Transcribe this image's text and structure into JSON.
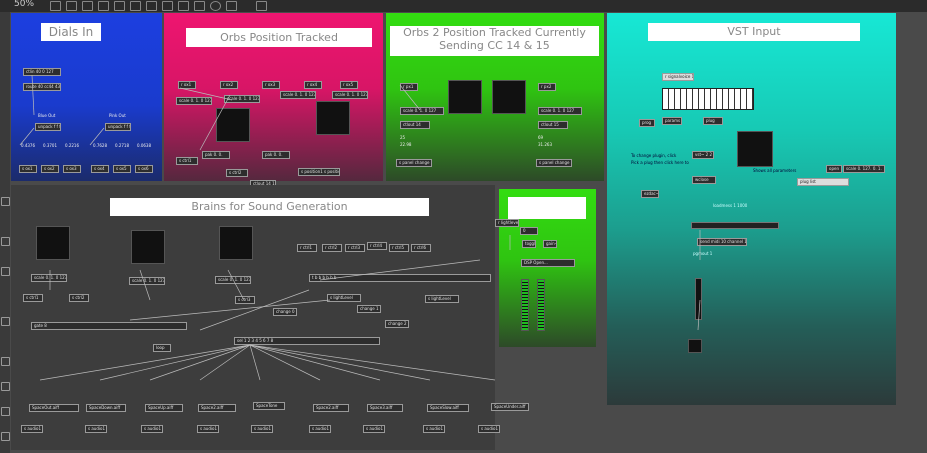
{
  "toolbar": {
    "zoom": "50%"
  },
  "panels": {
    "dials": {
      "title": "Dials In",
      "color": "#1f3fd6"
    },
    "orbs": {
      "title": "Orbs Position Tracked",
      "color": "#e8166b"
    },
    "orbs2": {
      "title": "Orbs 2 Position Tracked Currently Sending CC 14 & 15",
      "color": "#33cc11"
    },
    "vst": {
      "title": "VST Input",
      "color": "#1ae0d0"
    },
    "brains": {
      "title": "Brains for Sound Generation"
    },
    "green_small": {
      "title": ""
    }
  },
  "dials_objects": {
    "ctlin": "ctlin 40 0 127",
    "route": "route 40 cc44 43",
    "blue_out": "Blue Out",
    "pink_out": "Pink Out",
    "unpack1": "unpack f f f",
    "unpack2": "unpack f f f",
    "v1": "0.4376",
    "v2": "0.3701",
    "v3": "0.2216",
    "v4": "0.7628",
    "v5": "0.2718",
    "v6": "0.0638",
    "s1": "s ox1",
    "s2": "s ox2",
    "s3": "s ox3",
    "s4": "s ox4",
    "s5": "s ox5",
    "s6": "s ox6"
  },
  "orbs_objects": {
    "r1": "r ox1",
    "r2": "r ox2",
    "r3": "r ox3",
    "r4": "r ox4",
    "r5": "r ox5",
    "r6": "r ox6",
    "scale1": "scale 0. 1. 0 127",
    "scale2": "scale 0. 1. 0 127",
    "scale3": "scale 0. 1. 0 127",
    "scale4": "scale 0. 1. 0 127",
    "pak1": "pak 0. 0.",
    "pak2": "pak 0. 0.",
    "out1": "s ctrl1",
    "out2": "s ctrl2",
    "ctlout": "ctlout 14 1",
    "ctlout2": "s position1 s position2"
  },
  "orbs2_objects": {
    "r1": "r px1",
    "r2": "r px2",
    "scale1": "scale 0. 1. 0 127",
    "scale2": "scale 0. 1. 0 127",
    "ctl1": "ctlout 14",
    "ctl2": "ctlout 15",
    "v1": "25",
    "v2": "22.98",
    "v3": "69",
    "v4": "31.263",
    "change1": "s panel change",
    "change2": "s panel change"
  },
  "vst_objects": {
    "ctl": "r signalvoice 1",
    "prog": "prog",
    "params": "params",
    "plug": "plug",
    "vst": "vst~ 2 2",
    "open": "open",
    "scale": "scale 0. 127. 0. 1.",
    "label1": "To change plugin, click",
    "label2": "Pick a plug then click here to",
    "note": "Shows all parameters",
    "wclose": "wclose",
    "p_list": "plug list",
    "dac": "ezdac~",
    "midi": "send midi 10 channel 1",
    "pgm": "pgmout 1",
    "show": "loadmess 1 1000"
  },
  "brains_objects": {
    "r1": "r ctrl1",
    "r2": "r ctrl2",
    "r3": "r ctrl3",
    "scale1": "scale 0. 1. 0 127",
    "scale2": "scale 0. 1. 0 127",
    "scale3": "scale 0. 1. 0 127",
    "s1": "s ctrl1",
    "s2": "s ctrl2",
    "s3": "s ctrl3",
    "rs": [
      "r ctrl1",
      "r ctrl2",
      "r ctrl3",
      "r ctrl4",
      "r ctrl5",
      "r ctrl6"
    ],
    "trigger": "t b b b b b b",
    "change": "change 0",
    "change2": "change 1",
    "change3": "change 2",
    "sel": "sel 1 2 3 4 5 6 7 8",
    "gate": "gate 8",
    "pack": "pack 0 0",
    "loop": "loop",
    "route1": "route 1",
    "route2": "route 2",
    "lightlevel": "s lightLevel",
    "sfs": [
      "SpaceOut.aiff",
      "SpaceDown.aiff",
      "SpaceUp.aiff",
      "Space2.aiff",
      "SpaceTone",
      "Space2.aiff",
      "Space3.aiff",
      "SpaceSlow.aiff",
      "SpaceUnder.aiff"
    ],
    "out": "s audio1"
  },
  "green_objects": {
    "r": "r lightlevel",
    "toggle": "toggle",
    "gain": "gain~",
    "dsp": "DSP Open...",
    "meter_l": "meter~",
    "meter_r": "meter~",
    "num": "0"
  }
}
